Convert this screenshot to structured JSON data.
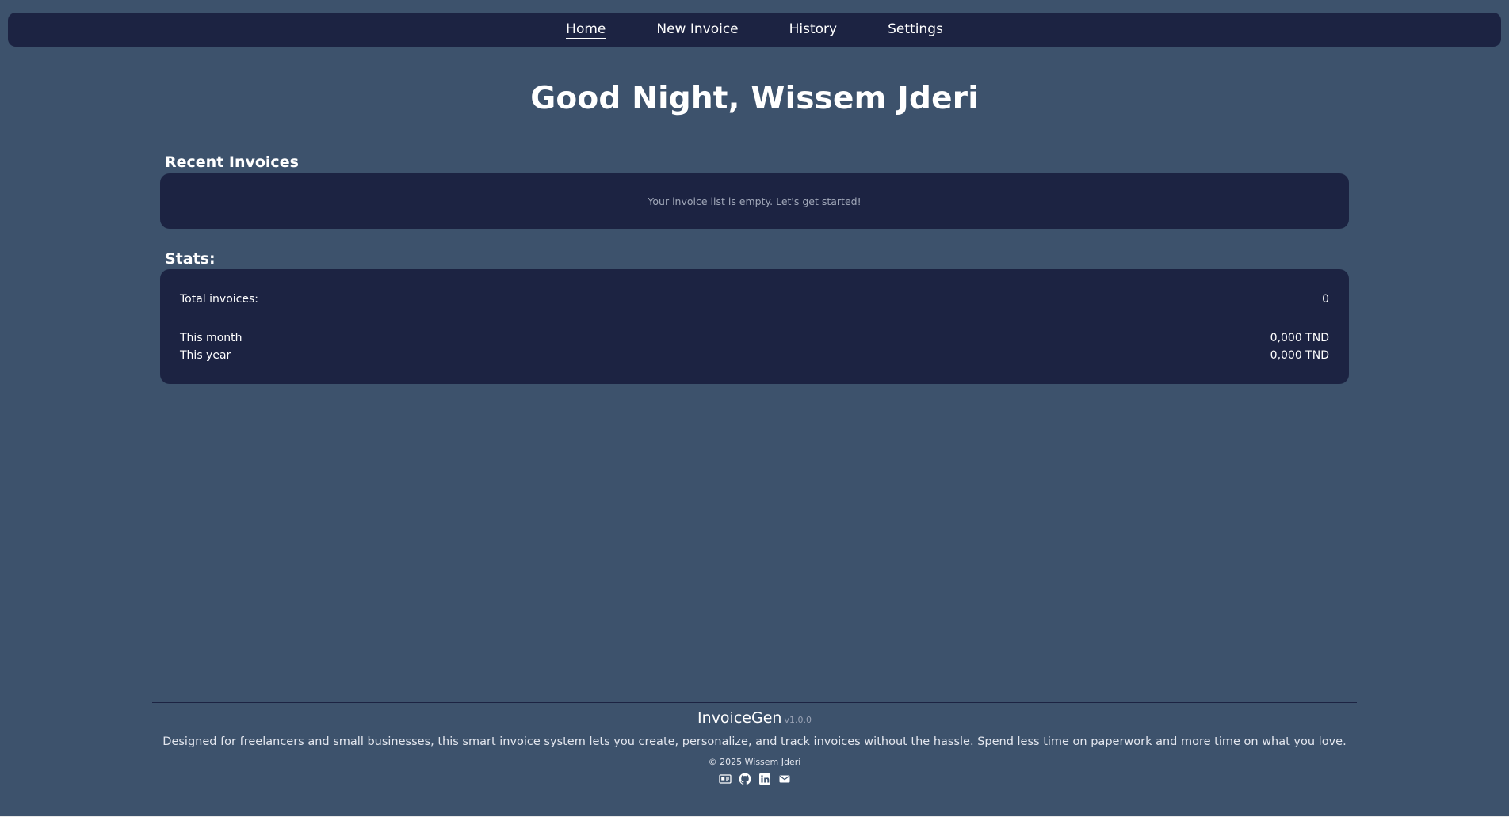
{
  "nav": {
    "items": [
      {
        "label": "Home",
        "active": true
      },
      {
        "label": "New Invoice",
        "active": false
      },
      {
        "label": "History",
        "active": false
      },
      {
        "label": "Settings",
        "active": false
      }
    ]
  },
  "greeting": "Good Night, Wissem Jderi",
  "recent": {
    "title": "Recent Invoices",
    "empty_message": "Your invoice list is empty. Let's get started!"
  },
  "stats": {
    "title": "Stats:",
    "total_label": "Total invoices:",
    "total_value": "0",
    "month_label": "This month",
    "month_value": "0,000 TND",
    "year_label": "This year",
    "year_value": "0,000 TND"
  },
  "footer": {
    "brand": "InvoiceGen",
    "version": "v1.0.0",
    "description": "Designed for freelancers and small businesses, this smart invoice system lets you create, personalize, and track invoices without the hassle. Spend less time on paperwork and more time on what you love.",
    "copyright": "© 2025 Wissem Jderi",
    "icons": [
      "id-card-icon",
      "github-icon",
      "linkedin-icon",
      "mail-icon"
    ]
  },
  "colors": {
    "background": "#3d526c",
    "panel": "#1c2342",
    "text": "#ffffff",
    "muted_text": "#a0a7b8"
  }
}
